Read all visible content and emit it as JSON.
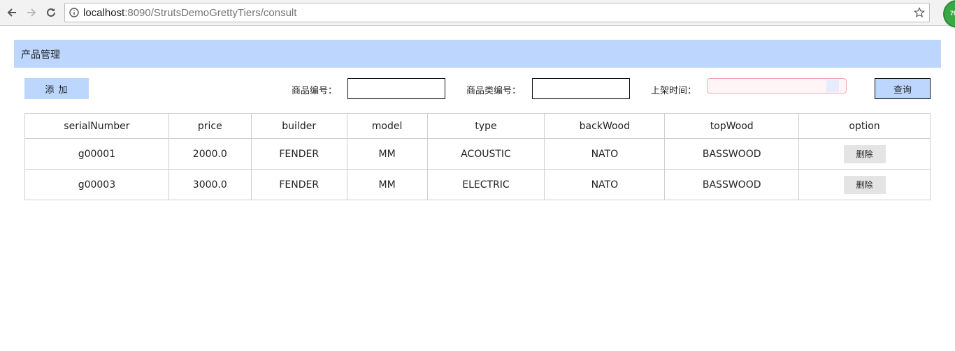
{
  "browser": {
    "url_host": "localhost",
    "url_path": ":8090/StrutsDemoGrettyTiers/consult",
    "extension_badge": "78"
  },
  "page": {
    "title": "产品管理",
    "add_label": "添 加",
    "filters": {
      "serial_label": "商品编号：",
      "category_label": "商品类编号：",
      "date_label": "上架时间：",
      "query_label": "查询"
    },
    "table": {
      "columns": [
        "serialNumber",
        "price",
        "builder",
        "model",
        "type",
        "backWood",
        "topWood",
        "option"
      ],
      "rows": [
        {
          "serialNumber": "g00001",
          "price": "2000.0",
          "builder": "FENDER",
          "model": "MM",
          "type": "ACOUSTIC",
          "backWood": "NATO",
          "topWood": "BASSWOOD",
          "option": "删除"
        },
        {
          "serialNumber": "g00003",
          "price": "3000.0",
          "builder": "FENDER",
          "model": "MM",
          "type": "ELECTRIC",
          "backWood": "NATO",
          "topWood": "BASSWOOD",
          "option": "删除"
        }
      ]
    }
  },
  "colors": {
    "accent": "#bdd6fd",
    "date_border": "#f2a9b4"
  }
}
